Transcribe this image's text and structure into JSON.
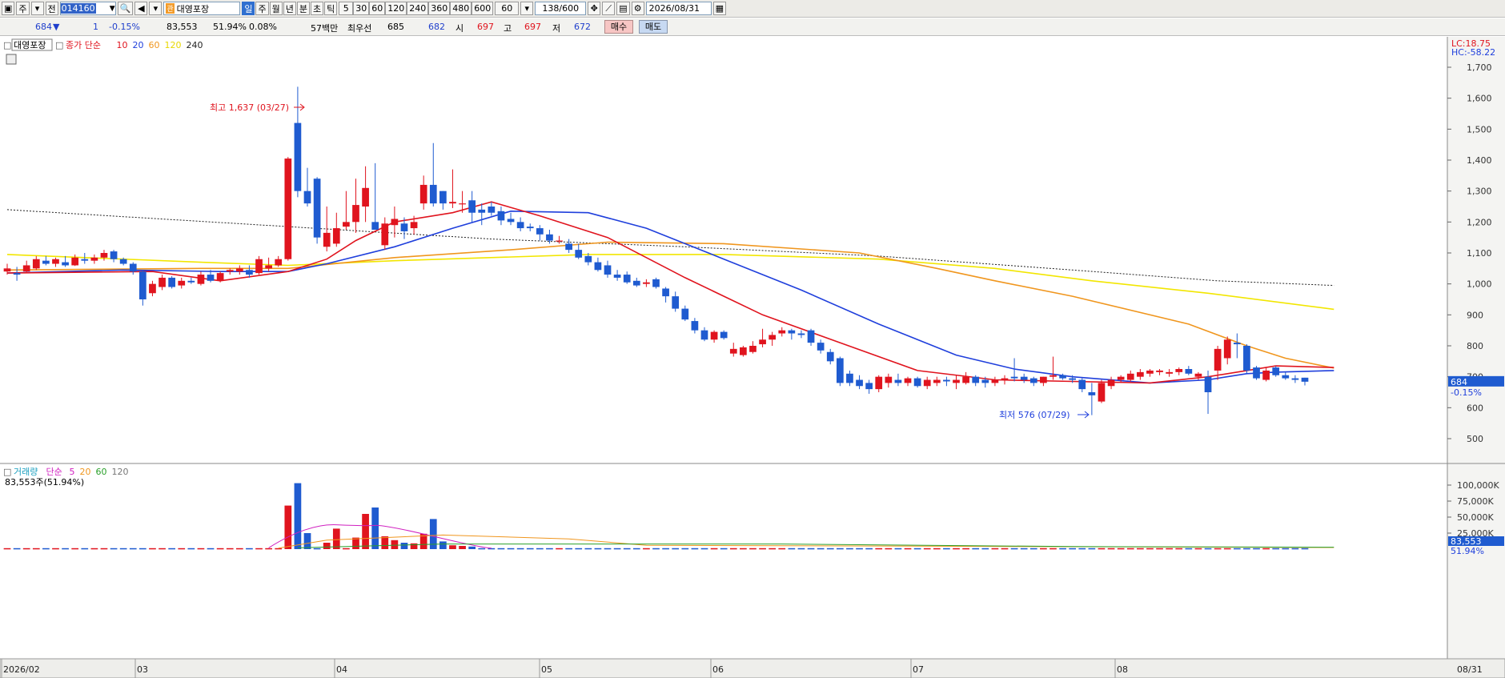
{
  "toolbar": {
    "market_label": "주",
    "type_label": "전",
    "code": "014160",
    "name": "대영포장",
    "name_badge": "관",
    "period_buttons": [
      "일",
      "주",
      "월",
      "년",
      "분",
      "초",
      "틱"
    ],
    "selected_period": "일",
    "interval_buttons": [
      "5",
      "30",
      "60",
      "120",
      "240",
      "360",
      "480",
      "600"
    ],
    "interval_value": "60",
    "count": "138",
    "count_max": "/600",
    "date": "2026/08/31"
  },
  "quote": {
    "price": "684",
    "change_arrow": "▼",
    "change": "1",
    "change_pct": "-0.15%",
    "volume": "83,553",
    "volume_ratio": "51.94%",
    "turnover": "0.08%",
    "amount_label": "57백만",
    "priority_label": "최우선",
    "ask": "685",
    "bid": "682",
    "open_label": "시",
    "open": "697",
    "high_label": "고",
    "high": "697",
    "low_label": "저",
    "low": "672",
    "buy_label": "매수",
    "sell_label": "매도"
  },
  "colors": {
    "up": "#e0141e",
    "down": "#1f5bd0",
    "ma10": "#e0141e",
    "ma20": "#1f3fdc",
    "ma60": "#f0961e",
    "ma120": "#f2e600",
    "ma240": "#222222"
  },
  "chart_data": {
    "type": "candlestick",
    "title": "대영포장",
    "legend": {
      "price_label": "종가 단순",
      "ma_periods": [
        "10",
        "20",
        "60",
        "120",
        "240"
      ]
    },
    "y_ticks": [
      "1,700",
      "1,600",
      "1,500",
      "1,400",
      "1,300",
      "1,200",
      "1,100",
      "1,000",
      "900",
      "800",
      "700",
      "600",
      "500"
    ],
    "y_range": [
      440,
      1790
    ],
    "lc_label": "LC:18.75",
    "hc_label": "HC:-58.22",
    "high_annotation": "최고 1,637 (03/27)",
    "low_annotation": "최저 576 (07/29)",
    "current_price_label": "684",
    "current_pct_label": "-0.15%",
    "x_labels": [
      "2026/02",
      "03",
      "04",
      "05",
      "06",
      "07",
      "08"
    ],
    "x_end_label": "08/31",
    "candles": [
      {
        "o": 1040,
        "h": 1065,
        "l": 1030,
        "c": 1050
      },
      {
        "o": 1035,
        "h": 1055,
        "l": 1010,
        "c": 1030
      },
      {
        "o": 1040,
        "h": 1075,
        "l": 1035,
        "c": 1060
      },
      {
        "o": 1050,
        "h": 1090,
        "l": 1045,
        "c": 1080
      },
      {
        "o": 1075,
        "h": 1090,
        "l": 1060,
        "c": 1065
      },
      {
        "o": 1065,
        "h": 1085,
        "l": 1055,
        "c": 1080
      },
      {
        "o": 1070,
        "h": 1090,
        "l": 1055,
        "c": 1060
      },
      {
        "o": 1060,
        "h": 1095,
        "l": 1058,
        "c": 1085
      },
      {
        "o": 1080,
        "h": 1100,
        "l": 1065,
        "c": 1075
      },
      {
        "o": 1075,
        "h": 1095,
        "l": 1065,
        "c": 1085
      },
      {
        "o": 1085,
        "h": 1110,
        "l": 1075,
        "c": 1100
      },
      {
        "o": 1105,
        "h": 1110,
        "l": 1070,
        "c": 1080
      },
      {
        "o": 1080,
        "h": 1085,
        "l": 1060,
        "c": 1065
      },
      {
        "o": 1065,
        "h": 1070,
        "l": 1030,
        "c": 1040
      },
      {
        "o": 1040,
        "h": 1045,
        "l": 930,
        "c": 950
      },
      {
        "o": 970,
        "h": 1010,
        "l": 960,
        "c": 1000
      },
      {
        "o": 990,
        "h": 1030,
        "l": 980,
        "c": 1020
      },
      {
        "o": 1020,
        "h": 1025,
        "l": 985,
        "c": 990
      },
      {
        "o": 995,
        "h": 1020,
        "l": 985,
        "c": 1010
      },
      {
        "o": 1010,
        "h": 1020,
        "l": 1000,
        "c": 1005
      },
      {
        "o": 1000,
        "h": 1040,
        "l": 995,
        "c": 1030
      },
      {
        "o": 1030,
        "h": 1045,
        "l": 1005,
        "c": 1010
      },
      {
        "o": 1010,
        "h": 1040,
        "l": 1005,
        "c": 1035
      },
      {
        "o": 1040,
        "h": 1050,
        "l": 1030,
        "c": 1045
      },
      {
        "o": 1040,
        "h": 1060,
        "l": 1030,
        "c": 1050
      },
      {
        "o": 1045,
        "h": 1060,
        "l": 1020,
        "c": 1030
      },
      {
        "o": 1035,
        "h": 1090,
        "l": 1030,
        "c": 1080
      },
      {
        "o": 1050,
        "h": 1085,
        "l": 1040,
        "c": 1060
      },
      {
        "o": 1060,
        "h": 1090,
        "l": 1055,
        "c": 1080
      },
      {
        "o": 1080,
        "h": 1410,
        "l": 1075,
        "c": 1405
      },
      {
        "o": 1520,
        "h": 1637,
        "l": 1280,
        "c": 1300
      },
      {
        "o": 1300,
        "h": 1375,
        "l": 1250,
        "c": 1260
      },
      {
        "o": 1340,
        "h": 1345,
        "l": 1130,
        "c": 1150
      },
      {
        "o": 1120,
        "h": 1250,
        "l": 1105,
        "c": 1165
      },
      {
        "o": 1130,
        "h": 1230,
        "l": 1120,
        "c": 1180
      },
      {
        "o": 1185,
        "h": 1300,
        "l": 1175,
        "c": 1200
      },
      {
        "o": 1200,
        "h": 1340,
        "l": 1165,
        "c": 1255
      },
      {
        "o": 1250,
        "h": 1380,
        "l": 1200,
        "c": 1310
      },
      {
        "o": 1200,
        "h": 1390,
        "l": 1190,
        "c": 1175
      },
      {
        "o": 1125,
        "h": 1215,
        "l": 1110,
        "c": 1195
      },
      {
        "o": 1190,
        "h": 1250,
        "l": 1150,
        "c": 1210
      },
      {
        "o": 1195,
        "h": 1215,
        "l": 1145,
        "c": 1170
      },
      {
        "o": 1180,
        "h": 1220,
        "l": 1160,
        "c": 1200
      },
      {
        "o": 1260,
        "h": 1350,
        "l": 1240,
        "c": 1320
      },
      {
        "o": 1320,
        "h": 1455,
        "l": 1250,
        "c": 1260
      },
      {
        "o": 1300,
        "h": 1300,
        "l": 1240,
        "c": 1260
      },
      {
        "o": 1260,
        "h": 1370,
        "l": 1245,
        "c": 1265
      },
      {
        "o": 1260,
        "h": 1300,
        "l": 1230,
        "c": 1260
      },
      {
        "o": 1270,
        "h": 1300,
        "l": 1200,
        "c": 1230
      },
      {
        "o": 1240,
        "h": 1260,
        "l": 1190,
        "c": 1230
      },
      {
        "o": 1250,
        "h": 1265,
        "l": 1220,
        "c": 1230
      },
      {
        "o": 1235,
        "h": 1250,
        "l": 1190,
        "c": 1205
      },
      {
        "o": 1210,
        "h": 1230,
        "l": 1190,
        "c": 1200
      },
      {
        "o": 1200,
        "h": 1215,
        "l": 1170,
        "c": 1180
      },
      {
        "o": 1185,
        "h": 1195,
        "l": 1170,
        "c": 1180
      },
      {
        "o": 1180,
        "h": 1190,
        "l": 1140,
        "c": 1160
      },
      {
        "o": 1160,
        "h": 1175,
        "l": 1130,
        "c": 1140
      },
      {
        "o": 1140,
        "h": 1155,
        "l": 1130,
        "c": 1140
      },
      {
        "o": 1130,
        "h": 1145,
        "l": 1100,
        "c": 1110
      },
      {
        "o": 1110,
        "h": 1130,
        "l": 1080,
        "c": 1085
      },
      {
        "o": 1090,
        "h": 1100,
        "l": 1060,
        "c": 1070
      },
      {
        "o": 1070,
        "h": 1085,
        "l": 1040,
        "c": 1045
      },
      {
        "o": 1060,
        "h": 1075,
        "l": 1020,
        "c": 1030
      },
      {
        "o": 1030,
        "h": 1045,
        "l": 1010,
        "c": 1020
      },
      {
        "o": 1030,
        "h": 1040,
        "l": 1000,
        "c": 1005
      },
      {
        "o": 1010,
        "h": 1020,
        "l": 990,
        "c": 995
      },
      {
        "o": 1000,
        "h": 1015,
        "l": 990,
        "c": 1005
      },
      {
        "o": 1015,
        "h": 1020,
        "l": 985,
        "c": 990
      },
      {
        "o": 985,
        "h": 990,
        "l": 940,
        "c": 960
      },
      {
        "o": 960,
        "h": 975,
        "l": 910,
        "c": 920
      },
      {
        "o": 920,
        "h": 930,
        "l": 880,
        "c": 885
      },
      {
        "o": 880,
        "h": 890,
        "l": 840,
        "c": 850
      },
      {
        "o": 850,
        "h": 860,
        "l": 815,
        "c": 820
      },
      {
        "o": 820,
        "h": 850,
        "l": 810,
        "c": 845
      },
      {
        "o": 845,
        "h": 850,
        "l": 820,
        "c": 825
      },
      {
        "o": 775,
        "h": 810,
        "l": 765,
        "c": 790
      },
      {
        "o": 770,
        "h": 800,
        "l": 765,
        "c": 795
      },
      {
        "o": 780,
        "h": 815,
        "l": 775,
        "c": 800
      },
      {
        "o": 805,
        "h": 855,
        "l": 795,
        "c": 820
      },
      {
        "o": 820,
        "h": 845,
        "l": 800,
        "c": 835
      },
      {
        "o": 840,
        "h": 860,
        "l": 830,
        "c": 850
      },
      {
        "o": 850,
        "h": 855,
        "l": 820,
        "c": 840
      },
      {
        "o": 840,
        "h": 850,
        "l": 825,
        "c": 835
      },
      {
        "o": 850,
        "h": 855,
        "l": 800,
        "c": 810
      },
      {
        "o": 810,
        "h": 820,
        "l": 775,
        "c": 785
      },
      {
        "o": 780,
        "h": 790,
        "l": 740,
        "c": 750
      },
      {
        "o": 760,
        "h": 765,
        "l": 670,
        "c": 680
      },
      {
        "o": 710,
        "h": 720,
        "l": 670,
        "c": 680
      },
      {
        "o": 690,
        "h": 705,
        "l": 660,
        "c": 670
      },
      {
        "o": 680,
        "h": 690,
        "l": 645,
        "c": 660
      },
      {
        "o": 660,
        "h": 705,
        "l": 650,
        "c": 700
      },
      {
        "o": 680,
        "h": 710,
        "l": 665,
        "c": 700
      },
      {
        "o": 690,
        "h": 710,
        "l": 670,
        "c": 680
      },
      {
        "o": 680,
        "h": 700,
        "l": 670,
        "c": 695
      },
      {
        "o": 695,
        "h": 700,
        "l": 665,
        "c": 670
      },
      {
        "o": 670,
        "h": 700,
        "l": 660,
        "c": 690
      },
      {
        "o": 680,
        "h": 700,
        "l": 670,
        "c": 690
      },
      {
        "o": 690,
        "h": 700,
        "l": 670,
        "c": 685
      },
      {
        "o": 680,
        "h": 705,
        "l": 660,
        "c": 690
      },
      {
        "o": 680,
        "h": 715,
        "l": 675,
        "c": 700
      },
      {
        "o": 700,
        "h": 705,
        "l": 670,
        "c": 680
      },
      {
        "o": 690,
        "h": 700,
        "l": 665,
        "c": 680
      },
      {
        "o": 680,
        "h": 700,
        "l": 670,
        "c": 690
      },
      {
        "o": 690,
        "h": 705,
        "l": 675,
        "c": 695
      },
      {
        "o": 700,
        "h": 760,
        "l": 685,
        "c": 695
      },
      {
        "o": 700,
        "h": 710,
        "l": 680,
        "c": 690
      },
      {
        "o": 695,
        "h": 700,
        "l": 670,
        "c": 680
      },
      {
        "o": 680,
        "h": 700,
        "l": 670,
        "c": 700
      },
      {
        "o": 700,
        "h": 765,
        "l": 690,
        "c": 705
      },
      {
        "o": 705,
        "h": 710,
        "l": 690,
        "c": 695
      },
      {
        "o": 695,
        "h": 705,
        "l": 680,
        "c": 690
      },
      {
        "o": 690,
        "h": 695,
        "l": 650,
        "c": 660
      },
      {
        "o": 650,
        "h": 680,
        "l": 576,
        "c": 640
      },
      {
        "o": 620,
        "h": 690,
        "l": 615,
        "c": 680
      },
      {
        "o": 670,
        "h": 700,
        "l": 660,
        "c": 690
      },
      {
        "o": 690,
        "h": 705,
        "l": 680,
        "c": 700
      },
      {
        "o": 690,
        "h": 720,
        "l": 685,
        "c": 710
      },
      {
        "o": 700,
        "h": 725,
        "l": 690,
        "c": 715
      },
      {
        "o": 710,
        "h": 725,
        "l": 700,
        "c": 720
      },
      {
        "o": 715,
        "h": 725,
        "l": 705,
        "c": 720
      },
      {
        "o": 710,
        "h": 725,
        "l": 700,
        "c": 715
      },
      {
        "o": 715,
        "h": 730,
        "l": 705,
        "c": 725
      },
      {
        "o": 725,
        "h": 735,
        "l": 705,
        "c": 710
      },
      {
        "o": 700,
        "h": 715,
        "l": 690,
        "c": 710
      },
      {
        "o": 700,
        "h": 720,
        "l": 580,
        "c": 650
      },
      {
        "o": 720,
        "h": 800,
        "l": 690,
        "c": 790
      },
      {
        "o": 760,
        "h": 830,
        "l": 740,
        "c": 820
      },
      {
        "o": 810,
        "h": 840,
        "l": 760,
        "c": 805
      },
      {
        "o": 800,
        "h": 805,
        "l": 710,
        "c": 720
      },
      {
        "o": 730,
        "h": 735,
        "l": 690,
        "c": 695
      },
      {
        "o": 690,
        "h": 730,
        "l": 685,
        "c": 720
      },
      {
        "o": 730,
        "h": 735,
        "l": 700,
        "c": 705
      },
      {
        "o": 705,
        "h": 715,
        "l": 690,
        "c": 695
      },
      {
        "o": 695,
        "h": 705,
        "l": 680,
        "c": 690
      },
      {
        "o": 697,
        "h": 697,
        "l": 672,
        "c": 684
      }
    ],
    "ma": {
      "ma10": [
        [
          0,
          1035
        ],
        [
          15,
          1040
        ],
        [
          22,
          1010
        ],
        [
          29,
          1040
        ],
        [
          33,
          1080
        ],
        [
          36,
          1140
        ],
        [
          40,
          1200
        ],
        [
          46,
          1230
        ],
        [
          50,
          1265
        ],
        [
          55,
          1220
        ],
        [
          62,
          1150
        ],
        [
          70,
          1020
        ],
        [
          78,
          900
        ],
        [
          86,
          810
        ],
        [
          94,
          720
        ],
        [
          102,
          690
        ],
        [
          110,
          685
        ],
        [
          118,
          680
        ],
        [
          124,
          700
        ],
        [
          128,
          720
        ],
        [
          131,
          735
        ],
        [
          137,
          730
        ]
      ],
      "ma20": [
        [
          0,
          1035
        ],
        [
          12,
          1045
        ],
        [
          22,
          1040
        ],
        [
          29,
          1040
        ],
        [
          33,
          1065
        ],
        [
          40,
          1120
        ],
        [
          46,
          1180
        ],
        [
          52,
          1235
        ],
        [
          60,
          1230
        ],
        [
          66,
          1180
        ],
        [
          74,
          1080
        ],
        [
          82,
          980
        ],
        [
          90,
          870
        ],
        [
          98,
          770
        ],
        [
          104,
          725
        ],
        [
          110,
          700
        ],
        [
          118,
          680
        ],
        [
          124,
          690
        ],
        [
          128,
          710
        ],
        [
          131,
          715
        ],
        [
          137,
          720
        ]
      ],
      "ma60": [
        [
          0,
          1045
        ],
        [
          20,
          1050
        ],
        [
          29,
          1050
        ],
        [
          40,
          1085
        ],
        [
          52,
          1110
        ],
        [
          62,
          1135
        ],
        [
          74,
          1130
        ],
        [
          88,
          1100
        ],
        [
          96,
          1050
        ],
        [
          102,
          1010
        ],
        [
          110,
          960
        ],
        [
          122,
          870
        ],
        [
          128,
          800
        ],
        [
          132,
          760
        ],
        [
          137,
          728
        ]
      ],
      "ma120": [
        [
          0,
          1095
        ],
        [
          20,
          1070
        ],
        [
          29,
          1060
        ],
        [
          40,
          1075
        ],
        [
          60,
          1095
        ],
        [
          74,
          1095
        ],
        [
          90,
          1080
        ],
        [
          102,
          1050
        ],
        [
          112,
          1010
        ],
        [
          124,
          970
        ],
        [
          137,
          918
        ]
      ],
      "ma240": [
        [
          0,
          1240
        ],
        [
          29,
          1185
        ],
        [
          50,
          1145
        ],
        [
          70,
          1120
        ],
        [
          90,
          1090
        ],
        [
          110,
          1045
        ],
        [
          125,
          1010
        ],
        [
          137,
          995
        ]
      ]
    },
    "volume_panel": {
      "title": "거래량",
      "legend_label": "단순",
      "ma_periods": [
        "5",
        "20",
        "60",
        "120"
      ],
      "summary": "83,553주(51.94%)",
      "y_ticks": [
        "100,000K",
        "75,000K",
        "50,000K",
        "25,000K"
      ],
      "y_range": [
        0,
        110000000
      ],
      "current_volume_label": "83,553",
      "current_pct_label": "51.94%",
      "spikes": [
        [
          29,
          68000000
        ],
        [
          30,
          103000000
        ],
        [
          31,
          25000000
        ],
        [
          33,
          10000000
        ],
        [
          34,
          32000000
        ],
        [
          36,
          18000000
        ],
        [
          37,
          55000000
        ],
        [
          38,
          65000000
        ],
        [
          39,
          20000000
        ],
        [
          40,
          14000000
        ],
        [
          41,
          10000000
        ],
        [
          42,
          9000000
        ],
        [
          43,
          24000000
        ],
        [
          44,
          47000000
        ],
        [
          45,
          12000000
        ],
        [
          46,
          6000000
        ],
        [
          47,
          5000000
        ],
        [
          48,
          4000000
        ]
      ]
    }
  }
}
